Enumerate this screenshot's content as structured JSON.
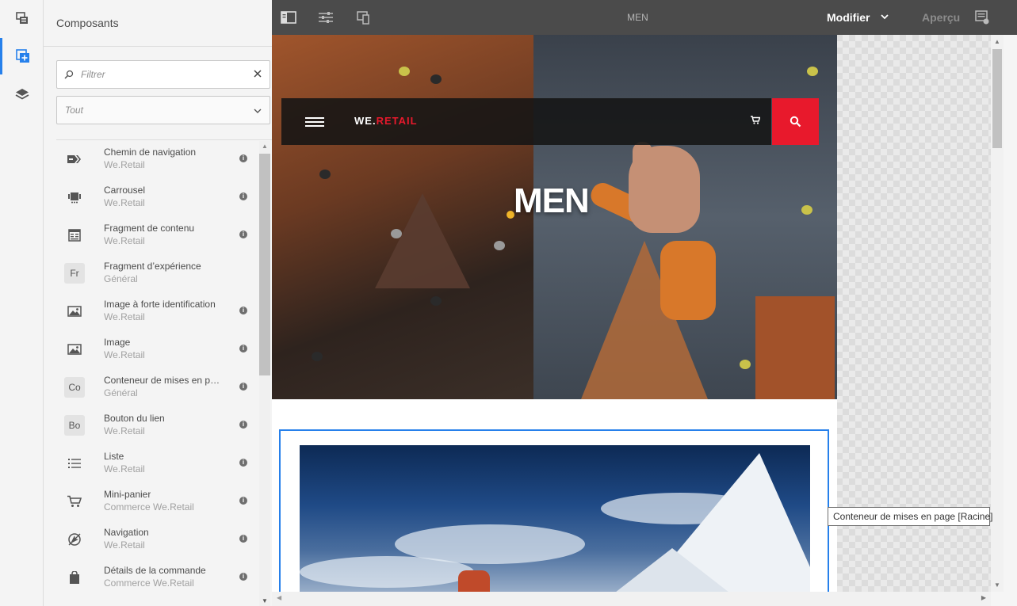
{
  "rail": {
    "items": [
      {
        "icon": "page-structure-icon"
      },
      {
        "icon": "components-icon",
        "active": true
      },
      {
        "icon": "layers-icon"
      }
    ]
  },
  "panel": {
    "title": "Composants",
    "filter": {
      "placeholder": "Filtrer",
      "value": ""
    },
    "group_select": "Tout",
    "components": [
      {
        "name": "Chemin de navigation",
        "group": "We.Retail",
        "icon": "breadcrumb-icon",
        "info": true
      },
      {
        "name": "Carrousel",
        "group": "We.Retail",
        "icon": "carousel-icon",
        "info": true
      },
      {
        "name": "Fragment de contenu",
        "group": "We.Retail",
        "icon": "content-fragment-icon",
        "info": true
      },
      {
        "name": "Fragment d’expérience",
        "group": "Général",
        "abbr": "Fr",
        "info": false
      },
      {
        "name": "Image à forte identification",
        "group": "We.Retail",
        "icon": "image-icon",
        "info": true
      },
      {
        "name": "Image",
        "group": "We.Retail",
        "icon": "image-icon",
        "info": true
      },
      {
        "name": "Conteneur de mises en pa...",
        "group": "Général",
        "abbr": "Co",
        "info": true
      },
      {
        "name": "Bouton du lien",
        "group": "We.Retail",
        "abbr": "Bo",
        "info": true
      },
      {
        "name": "Liste",
        "group": "We.Retail",
        "icon": "list-icon",
        "info": true
      },
      {
        "name": "Mini-panier",
        "group": "Commerce We.Retail",
        "icon": "cart-icon",
        "info": true
      },
      {
        "name": "Navigation",
        "group": "We.Retail",
        "icon": "navigation-icon",
        "info": true
      },
      {
        "name": "Détails de la commande",
        "group": "Commerce We.Retail",
        "icon": "shopping-bag-icon",
        "info": true
      }
    ]
  },
  "toolbar": {
    "page_title": "MEN",
    "mode": "Modifier",
    "preview": "Aperçu"
  },
  "site": {
    "logo_main": "WE.",
    "logo_accent": "RETAIL",
    "hero_title": "MEN",
    "bottom_text": "...."
  },
  "tooltip": "Conteneur de mises en page [Racine]",
  "colors": {
    "accent": "#2680eb",
    "brand_red": "#e8192c",
    "toolbar_bg": "#4b4b4b"
  }
}
